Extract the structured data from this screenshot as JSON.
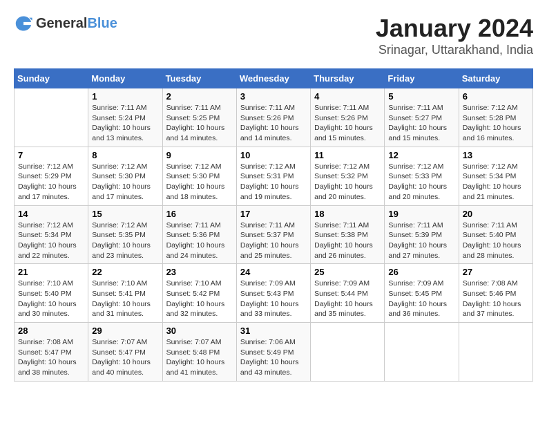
{
  "header": {
    "logo_general": "General",
    "logo_blue": "Blue",
    "title": "January 2024",
    "subtitle": "Srinagar, Uttarakhand, India"
  },
  "weekdays": [
    "Sunday",
    "Monday",
    "Tuesday",
    "Wednesday",
    "Thursday",
    "Friday",
    "Saturday"
  ],
  "weeks": [
    [
      {
        "day": "",
        "info": ""
      },
      {
        "day": "1",
        "info": "Sunrise: 7:11 AM\nSunset: 5:24 PM\nDaylight: 10 hours\nand 13 minutes."
      },
      {
        "day": "2",
        "info": "Sunrise: 7:11 AM\nSunset: 5:25 PM\nDaylight: 10 hours\nand 14 minutes."
      },
      {
        "day": "3",
        "info": "Sunrise: 7:11 AM\nSunset: 5:26 PM\nDaylight: 10 hours\nand 14 minutes."
      },
      {
        "day": "4",
        "info": "Sunrise: 7:11 AM\nSunset: 5:26 PM\nDaylight: 10 hours\nand 15 minutes."
      },
      {
        "day": "5",
        "info": "Sunrise: 7:11 AM\nSunset: 5:27 PM\nDaylight: 10 hours\nand 15 minutes."
      },
      {
        "day": "6",
        "info": "Sunrise: 7:12 AM\nSunset: 5:28 PM\nDaylight: 10 hours\nand 16 minutes."
      }
    ],
    [
      {
        "day": "7",
        "info": "Sunrise: 7:12 AM\nSunset: 5:29 PM\nDaylight: 10 hours\nand 17 minutes."
      },
      {
        "day": "8",
        "info": "Sunrise: 7:12 AM\nSunset: 5:30 PM\nDaylight: 10 hours\nand 17 minutes."
      },
      {
        "day": "9",
        "info": "Sunrise: 7:12 AM\nSunset: 5:30 PM\nDaylight: 10 hours\nand 18 minutes."
      },
      {
        "day": "10",
        "info": "Sunrise: 7:12 AM\nSunset: 5:31 PM\nDaylight: 10 hours\nand 19 minutes."
      },
      {
        "day": "11",
        "info": "Sunrise: 7:12 AM\nSunset: 5:32 PM\nDaylight: 10 hours\nand 20 minutes."
      },
      {
        "day": "12",
        "info": "Sunrise: 7:12 AM\nSunset: 5:33 PM\nDaylight: 10 hours\nand 20 minutes."
      },
      {
        "day": "13",
        "info": "Sunrise: 7:12 AM\nSunset: 5:34 PM\nDaylight: 10 hours\nand 21 minutes."
      }
    ],
    [
      {
        "day": "14",
        "info": "Sunrise: 7:12 AM\nSunset: 5:34 PM\nDaylight: 10 hours\nand 22 minutes."
      },
      {
        "day": "15",
        "info": "Sunrise: 7:12 AM\nSunset: 5:35 PM\nDaylight: 10 hours\nand 23 minutes."
      },
      {
        "day": "16",
        "info": "Sunrise: 7:11 AM\nSunset: 5:36 PM\nDaylight: 10 hours\nand 24 minutes."
      },
      {
        "day": "17",
        "info": "Sunrise: 7:11 AM\nSunset: 5:37 PM\nDaylight: 10 hours\nand 25 minutes."
      },
      {
        "day": "18",
        "info": "Sunrise: 7:11 AM\nSunset: 5:38 PM\nDaylight: 10 hours\nand 26 minutes."
      },
      {
        "day": "19",
        "info": "Sunrise: 7:11 AM\nSunset: 5:39 PM\nDaylight: 10 hours\nand 27 minutes."
      },
      {
        "day": "20",
        "info": "Sunrise: 7:11 AM\nSunset: 5:40 PM\nDaylight: 10 hours\nand 28 minutes."
      }
    ],
    [
      {
        "day": "21",
        "info": "Sunrise: 7:10 AM\nSunset: 5:40 PM\nDaylight: 10 hours\nand 30 minutes."
      },
      {
        "day": "22",
        "info": "Sunrise: 7:10 AM\nSunset: 5:41 PM\nDaylight: 10 hours\nand 31 minutes."
      },
      {
        "day": "23",
        "info": "Sunrise: 7:10 AM\nSunset: 5:42 PM\nDaylight: 10 hours\nand 32 minutes."
      },
      {
        "day": "24",
        "info": "Sunrise: 7:09 AM\nSunset: 5:43 PM\nDaylight: 10 hours\nand 33 minutes."
      },
      {
        "day": "25",
        "info": "Sunrise: 7:09 AM\nSunset: 5:44 PM\nDaylight: 10 hours\nand 35 minutes."
      },
      {
        "day": "26",
        "info": "Sunrise: 7:09 AM\nSunset: 5:45 PM\nDaylight: 10 hours\nand 36 minutes."
      },
      {
        "day": "27",
        "info": "Sunrise: 7:08 AM\nSunset: 5:46 PM\nDaylight: 10 hours\nand 37 minutes."
      }
    ],
    [
      {
        "day": "28",
        "info": "Sunrise: 7:08 AM\nSunset: 5:47 PM\nDaylight: 10 hours\nand 38 minutes."
      },
      {
        "day": "29",
        "info": "Sunrise: 7:07 AM\nSunset: 5:47 PM\nDaylight: 10 hours\nand 40 minutes."
      },
      {
        "day": "30",
        "info": "Sunrise: 7:07 AM\nSunset: 5:48 PM\nDaylight: 10 hours\nand 41 minutes."
      },
      {
        "day": "31",
        "info": "Sunrise: 7:06 AM\nSunset: 5:49 PM\nDaylight: 10 hours\nand 43 minutes."
      },
      {
        "day": "",
        "info": ""
      },
      {
        "day": "",
        "info": ""
      },
      {
        "day": "",
        "info": ""
      }
    ]
  ]
}
